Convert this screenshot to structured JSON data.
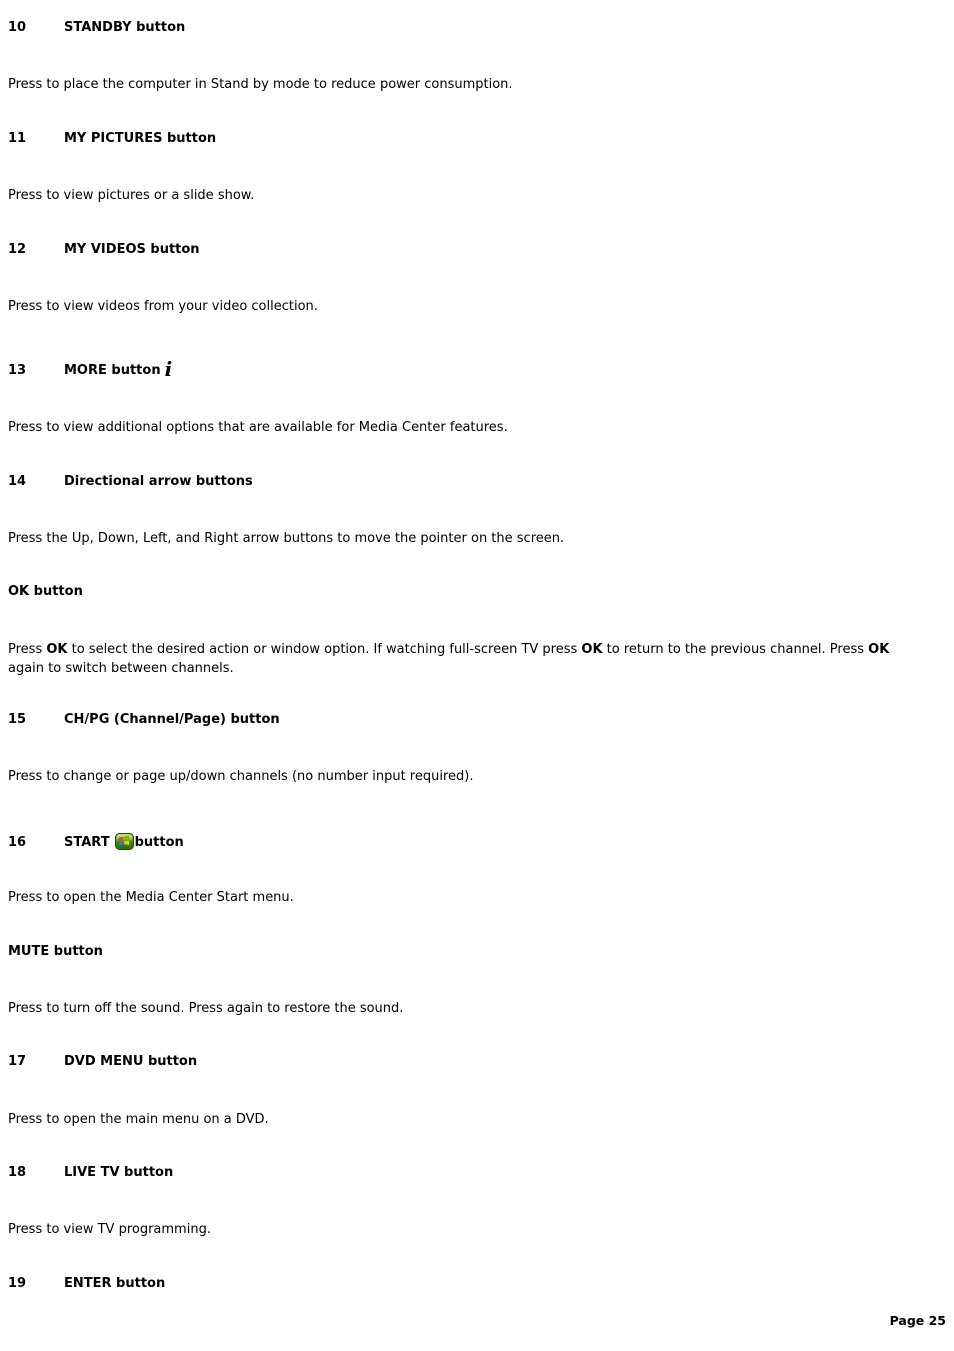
{
  "page": {
    "background": "#ffffff",
    "text_color": "#000000",
    "footer_label": "Page 25"
  },
  "icons": {
    "more_glyph": "i",
    "more_icon_name": "more-info-i-icon",
    "start_icon_name": "media-center-start-icon",
    "start_icon_colors": {
      "body_light": "#8cc63f",
      "body_mid": "#4a9e1f",
      "body_dark": "#2f6b10",
      "flag_red": "#e8433a",
      "flag_green": "#7ab800",
      "flag_blue": "#2a7fd4",
      "flag_yellow": "#f5c518"
    }
  },
  "entries": [
    {
      "number": "10",
      "label": "STANDBY button",
      "icon": null,
      "body": "Press to place the computer in Stand by mode to reduce power consumption."
    },
    {
      "number": "11",
      "label": "MY PICTURES button",
      "icon": null,
      "body": "Press to view pictures or a slide show."
    },
    {
      "number": "12",
      "label": "MY VIDEOS button",
      "icon": null,
      "body": "Press to view videos from your video collection."
    },
    {
      "number": "13",
      "label": "MORE button",
      "icon": "more-info-i-icon",
      "body": "Press to view additional options that are available for Media Center features."
    },
    {
      "number": "14",
      "label": "Directional arrow buttons",
      "icon": null,
      "body": "Press the Up, Down, Left, and Right arrow buttons to move the pointer on the screen."
    },
    {
      "number": "",
      "label": "OK button",
      "icon": null,
      "body_rich": {
        "part1": "Press ",
        "bold1": "OK",
        "part2": " to select the desired action or window option. If watching full-screen TV press ",
        "bold2": "OK",
        "part3": " to return to the previous channel. Press ",
        "bold3": "OK",
        "part4": " again to switch between channels."
      }
    },
    {
      "number": "15",
      "label": "CH/PG (Channel/Page) button",
      "icon": null,
      "body": "Press to change or page up/down channels (no number input required)."
    },
    {
      "number": "16",
      "label_before_icon": "START",
      "label_after_icon": "button",
      "icon": "media-center-start-icon",
      "body": "Press to open the Media Center Start menu."
    },
    {
      "number": "",
      "label": "MUTE button",
      "icon": null,
      "body": "Press to turn off the sound. Press again to restore the sound."
    },
    {
      "number": "17",
      "label": "DVD MENU button",
      "icon": null,
      "body": "Press to open the main menu on a DVD."
    },
    {
      "number": "18",
      "label": "LIVE TV button",
      "icon": null,
      "body": "Press to view TV programming."
    },
    {
      "number": "19",
      "label": "ENTER button",
      "icon": null,
      "body": ""
    }
  ]
}
